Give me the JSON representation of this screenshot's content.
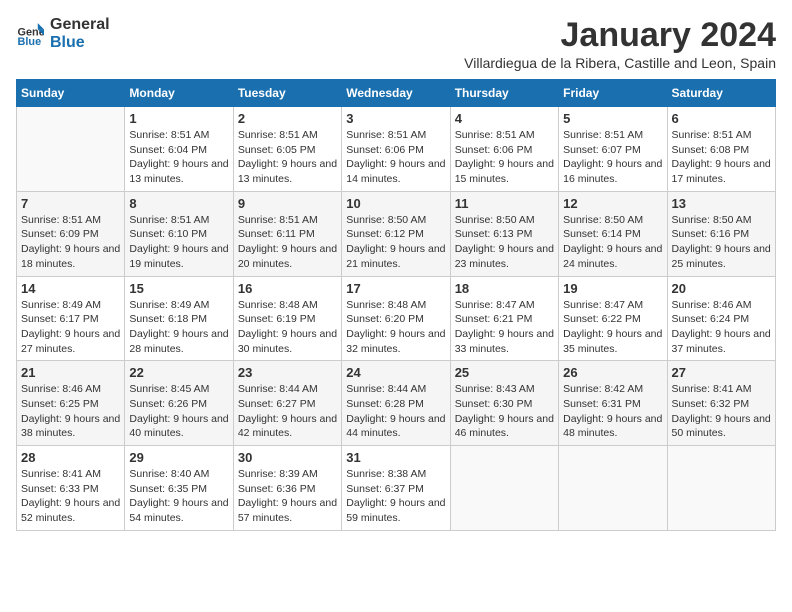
{
  "header": {
    "logo_general": "General",
    "logo_blue": "Blue",
    "month_title": "January 2024",
    "subtitle": "Villardiegua de la Ribera, Castille and Leon, Spain"
  },
  "columns": [
    "Sunday",
    "Monday",
    "Tuesday",
    "Wednesday",
    "Thursday",
    "Friday",
    "Saturday"
  ],
  "weeks": [
    [
      {
        "day": "",
        "empty": true
      },
      {
        "day": "1",
        "sunrise": "Sunrise: 8:51 AM",
        "sunset": "Sunset: 6:04 PM",
        "daylight": "Daylight: 9 hours and 13 minutes."
      },
      {
        "day": "2",
        "sunrise": "Sunrise: 8:51 AM",
        "sunset": "Sunset: 6:05 PM",
        "daylight": "Daylight: 9 hours and 13 minutes."
      },
      {
        "day": "3",
        "sunrise": "Sunrise: 8:51 AM",
        "sunset": "Sunset: 6:06 PM",
        "daylight": "Daylight: 9 hours and 14 minutes."
      },
      {
        "day": "4",
        "sunrise": "Sunrise: 8:51 AM",
        "sunset": "Sunset: 6:06 PM",
        "daylight": "Daylight: 9 hours and 15 minutes."
      },
      {
        "day": "5",
        "sunrise": "Sunrise: 8:51 AM",
        "sunset": "Sunset: 6:07 PM",
        "daylight": "Daylight: 9 hours and 16 minutes."
      },
      {
        "day": "6",
        "sunrise": "Sunrise: 8:51 AM",
        "sunset": "Sunset: 6:08 PM",
        "daylight": "Daylight: 9 hours and 17 minutes."
      }
    ],
    [
      {
        "day": "7",
        "sunrise": "Sunrise: 8:51 AM",
        "sunset": "Sunset: 6:09 PM",
        "daylight": "Daylight: 9 hours and 18 minutes."
      },
      {
        "day": "8",
        "sunrise": "Sunrise: 8:51 AM",
        "sunset": "Sunset: 6:10 PM",
        "daylight": "Daylight: 9 hours and 19 minutes."
      },
      {
        "day": "9",
        "sunrise": "Sunrise: 8:51 AM",
        "sunset": "Sunset: 6:11 PM",
        "daylight": "Daylight: 9 hours and 20 minutes."
      },
      {
        "day": "10",
        "sunrise": "Sunrise: 8:50 AM",
        "sunset": "Sunset: 6:12 PM",
        "daylight": "Daylight: 9 hours and 21 minutes."
      },
      {
        "day": "11",
        "sunrise": "Sunrise: 8:50 AM",
        "sunset": "Sunset: 6:13 PM",
        "daylight": "Daylight: 9 hours and 23 minutes."
      },
      {
        "day": "12",
        "sunrise": "Sunrise: 8:50 AM",
        "sunset": "Sunset: 6:14 PM",
        "daylight": "Daylight: 9 hours and 24 minutes."
      },
      {
        "day": "13",
        "sunrise": "Sunrise: 8:50 AM",
        "sunset": "Sunset: 6:16 PM",
        "daylight": "Daylight: 9 hours and 25 minutes."
      }
    ],
    [
      {
        "day": "14",
        "sunrise": "Sunrise: 8:49 AM",
        "sunset": "Sunset: 6:17 PM",
        "daylight": "Daylight: 9 hours and 27 minutes."
      },
      {
        "day": "15",
        "sunrise": "Sunrise: 8:49 AM",
        "sunset": "Sunset: 6:18 PM",
        "daylight": "Daylight: 9 hours and 28 minutes."
      },
      {
        "day": "16",
        "sunrise": "Sunrise: 8:48 AM",
        "sunset": "Sunset: 6:19 PM",
        "daylight": "Daylight: 9 hours and 30 minutes."
      },
      {
        "day": "17",
        "sunrise": "Sunrise: 8:48 AM",
        "sunset": "Sunset: 6:20 PM",
        "daylight": "Daylight: 9 hours and 32 minutes."
      },
      {
        "day": "18",
        "sunrise": "Sunrise: 8:47 AM",
        "sunset": "Sunset: 6:21 PM",
        "daylight": "Daylight: 9 hours and 33 minutes."
      },
      {
        "day": "19",
        "sunrise": "Sunrise: 8:47 AM",
        "sunset": "Sunset: 6:22 PM",
        "daylight": "Daylight: 9 hours and 35 minutes."
      },
      {
        "day": "20",
        "sunrise": "Sunrise: 8:46 AM",
        "sunset": "Sunset: 6:24 PM",
        "daylight": "Daylight: 9 hours and 37 minutes."
      }
    ],
    [
      {
        "day": "21",
        "sunrise": "Sunrise: 8:46 AM",
        "sunset": "Sunset: 6:25 PM",
        "daylight": "Daylight: 9 hours and 38 minutes."
      },
      {
        "day": "22",
        "sunrise": "Sunrise: 8:45 AM",
        "sunset": "Sunset: 6:26 PM",
        "daylight": "Daylight: 9 hours and 40 minutes."
      },
      {
        "day": "23",
        "sunrise": "Sunrise: 8:44 AM",
        "sunset": "Sunset: 6:27 PM",
        "daylight": "Daylight: 9 hours and 42 minutes."
      },
      {
        "day": "24",
        "sunrise": "Sunrise: 8:44 AM",
        "sunset": "Sunset: 6:28 PM",
        "daylight": "Daylight: 9 hours and 44 minutes."
      },
      {
        "day": "25",
        "sunrise": "Sunrise: 8:43 AM",
        "sunset": "Sunset: 6:30 PM",
        "daylight": "Daylight: 9 hours and 46 minutes."
      },
      {
        "day": "26",
        "sunrise": "Sunrise: 8:42 AM",
        "sunset": "Sunset: 6:31 PM",
        "daylight": "Daylight: 9 hours and 48 minutes."
      },
      {
        "day": "27",
        "sunrise": "Sunrise: 8:41 AM",
        "sunset": "Sunset: 6:32 PM",
        "daylight": "Daylight: 9 hours and 50 minutes."
      }
    ],
    [
      {
        "day": "28",
        "sunrise": "Sunrise: 8:41 AM",
        "sunset": "Sunset: 6:33 PM",
        "daylight": "Daylight: 9 hours and 52 minutes."
      },
      {
        "day": "29",
        "sunrise": "Sunrise: 8:40 AM",
        "sunset": "Sunset: 6:35 PM",
        "daylight": "Daylight: 9 hours and 54 minutes."
      },
      {
        "day": "30",
        "sunrise": "Sunrise: 8:39 AM",
        "sunset": "Sunset: 6:36 PM",
        "daylight": "Daylight: 9 hours and 57 minutes."
      },
      {
        "day": "31",
        "sunrise": "Sunrise: 8:38 AM",
        "sunset": "Sunset: 6:37 PM",
        "daylight": "Daylight: 9 hours and 59 minutes."
      },
      {
        "day": "",
        "empty": true
      },
      {
        "day": "",
        "empty": true
      },
      {
        "day": "",
        "empty": true
      }
    ]
  ]
}
